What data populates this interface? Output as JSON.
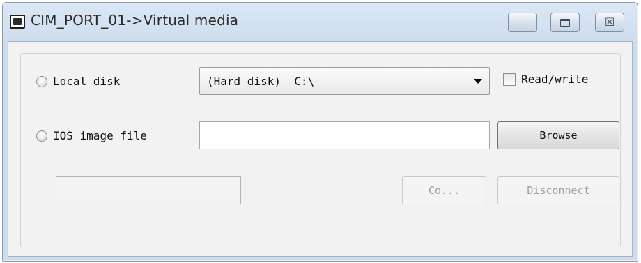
{
  "window": {
    "title": "CIM_PORT_01->Virtual media",
    "controls": {
      "minimize_icon": "minimize-icon",
      "maximize_icon": "maximize-icon",
      "close_icon": "close-icon",
      "close_glyph": "☒"
    }
  },
  "options": {
    "local_disk": {
      "label": "Local disk",
      "selected": false
    },
    "iso_image": {
      "label": "IOS image file",
      "selected": false
    }
  },
  "drive_select": {
    "value": "(Hard disk)  C:\\"
  },
  "read_write": {
    "label": "Read/write",
    "checked": false
  },
  "image_path": {
    "value": "",
    "placeholder": ""
  },
  "buttons": {
    "browse": "Browse",
    "connect": "Co...",
    "disconnect": "Disconnect"
  },
  "status": {
    "value": ""
  }
}
